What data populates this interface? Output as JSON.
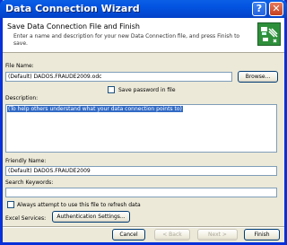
{
  "window": {
    "title": "Data Connection Wizard"
  },
  "header": {
    "title": "Save Data Connection File and Finish",
    "subtitle": "Enter a name and description for your new Data Connection file, and press Finish to save."
  },
  "form": {
    "file_name_label": "File Name:",
    "file_name_value": "(Default) DADOS.FRAUDE2009.odc",
    "browse_label": "Browse...",
    "save_password_label": "Save password in file",
    "description_label": "Description:",
    "description_value": "(To help others understand what your data connection points to)",
    "friendly_name_label": "Friendly Name:",
    "friendly_name_value": "(Default) DADOS.FRAUDE2009",
    "search_keywords_label": "Search Keywords:",
    "search_keywords_value": "",
    "always_attempt_label": "Always attempt to use this file to refresh data",
    "excel_services_label": "Excel Services:",
    "auth_settings_label": "Authentication Settings..."
  },
  "footer": {
    "cancel_label": "Cancel",
    "back_label": "< Back",
    "next_label": "Next >",
    "finish_label": "Finish"
  }
}
